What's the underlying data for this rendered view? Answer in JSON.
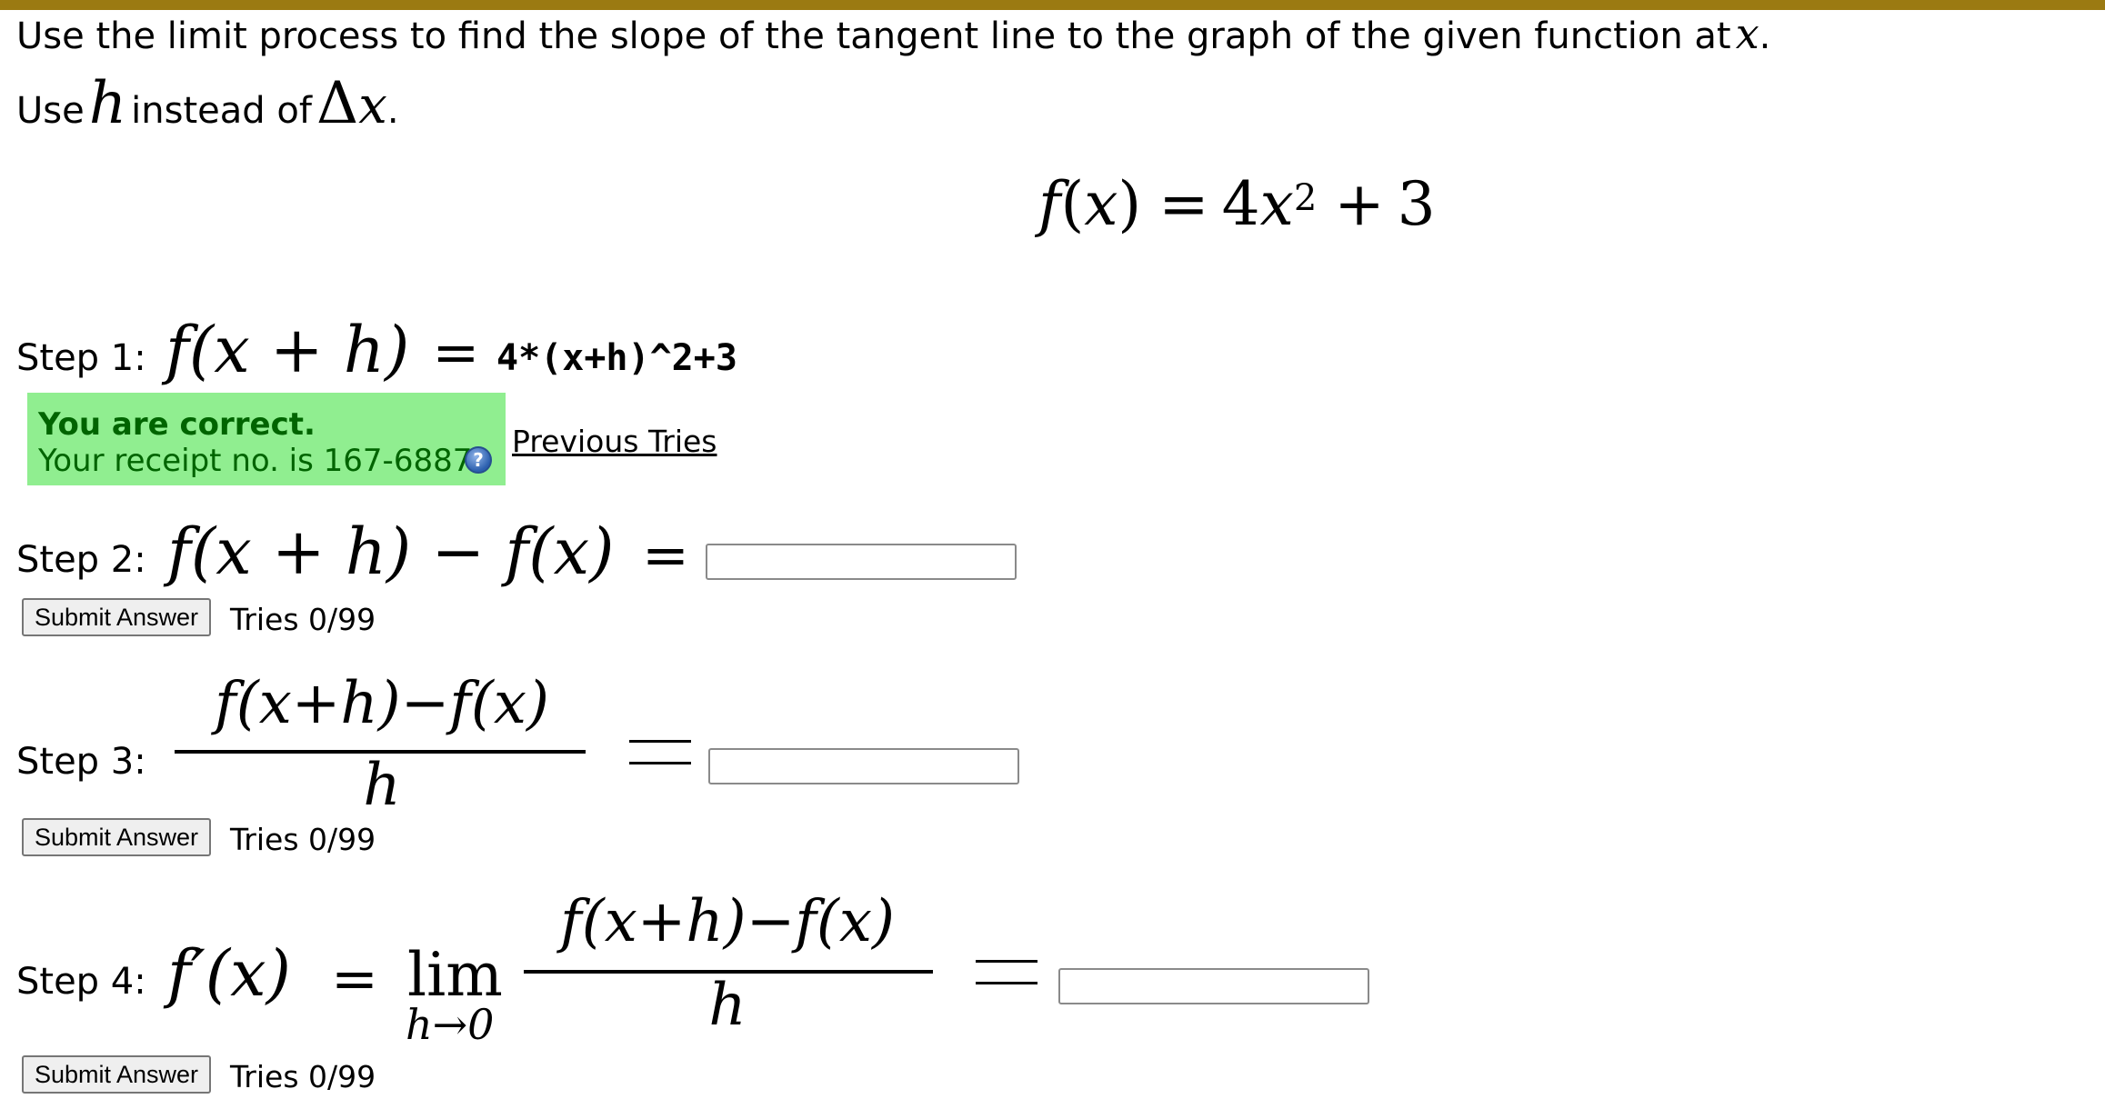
{
  "instructions": {
    "line1": "Use the limit process to find the slope of the tangent line to the graph of the given function at",
    "line1_var": "x",
    "line1_end": ".",
    "line2_pre": "Use",
    "line2_h": "h",
    "line2_mid": "instead of",
    "line2_delta": "Δ",
    "line2_x": "x",
    "line2_end": "."
  },
  "function": {
    "f": "f",
    "lparen": "(",
    "x": "x",
    "rparen": ")",
    "eq": "=",
    "coef": "4",
    "var": "x",
    "exp": "2",
    "plus": "+",
    "const": "3"
  },
  "steps": {
    "step1": {
      "label": "Step 1:",
      "expr_f": "f",
      "expr_args": "(x + h)",
      "eq": "=",
      "answer": "4*(x+h)^2+3",
      "feedback_title": "You are correct.",
      "feedback_receipt": "Your receipt no. is 167-6887",
      "help_icon": "?",
      "previous_tries": "Previous Tries"
    },
    "step2": {
      "label": "Step 2:",
      "expr": "f(x + h) − f(x)",
      "eq": "=",
      "input_value": "",
      "submit_label": "Submit Answer",
      "tries": "Tries 0/99"
    },
    "step3": {
      "label": "Step 3:",
      "numerator": "f(x+h)−f(x)",
      "denominator": "h",
      "input_value": "",
      "submit_label": "Submit Answer",
      "tries": "Tries 0/99"
    },
    "step4": {
      "label": "Step 4:",
      "lhs": "f′(x)",
      "eq": "=",
      "lim": "lim",
      "lim_sub": "h→0",
      "numerator": "f(x+h)−f(x)",
      "denominator": "h",
      "input_value": "",
      "submit_label": "Submit Answer",
      "tries": "Tries 0/99"
    }
  },
  "colors": {
    "top_bar": "#9b7a12",
    "correct_bg": "#90ee90",
    "correct_text": "#006400"
  }
}
